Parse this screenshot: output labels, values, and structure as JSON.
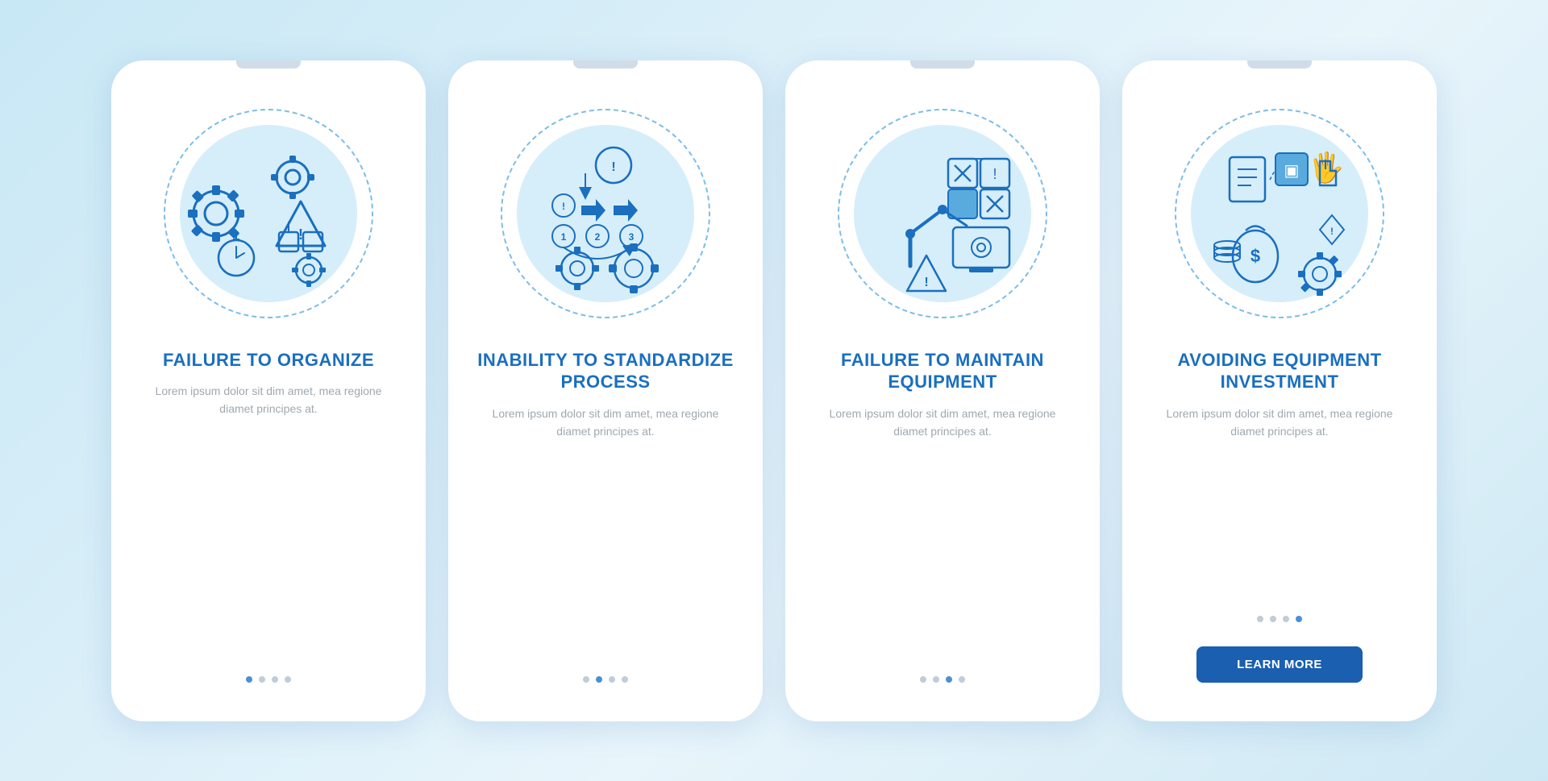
{
  "background": "#c8e8f5",
  "cards": [
    {
      "id": "card1",
      "title": "FAILURE TO ORGANIZE",
      "body": "Lorem ipsum dolor sit dim amet, mea regione diamet principes at.",
      "dots": [
        true,
        false,
        false,
        false
      ],
      "show_button": false,
      "button_label": ""
    },
    {
      "id": "card2",
      "title": "INABILITY TO STANDARDIZE PROCESS",
      "body": "Lorem ipsum dolor sit dim amet, mea regione diamet principes at.",
      "dots": [
        false,
        true,
        false,
        false
      ],
      "show_button": false,
      "button_label": ""
    },
    {
      "id": "card3",
      "title": "FAILURE TO MAINTAIN EQUIPMENT",
      "body": "Lorem ipsum dolor sit dim amet, mea regione diamet principes at.",
      "dots": [
        false,
        false,
        true,
        false
      ],
      "show_button": false,
      "button_label": ""
    },
    {
      "id": "card4",
      "title": "AVOIDING EQUIPMENT INVESTMENT",
      "body": "Lorem ipsum dolor sit dim amet, mea regione diamet principes at.",
      "dots": [
        false,
        false,
        false,
        true
      ],
      "show_button": true,
      "button_label": "LEARN MORE"
    }
  ]
}
